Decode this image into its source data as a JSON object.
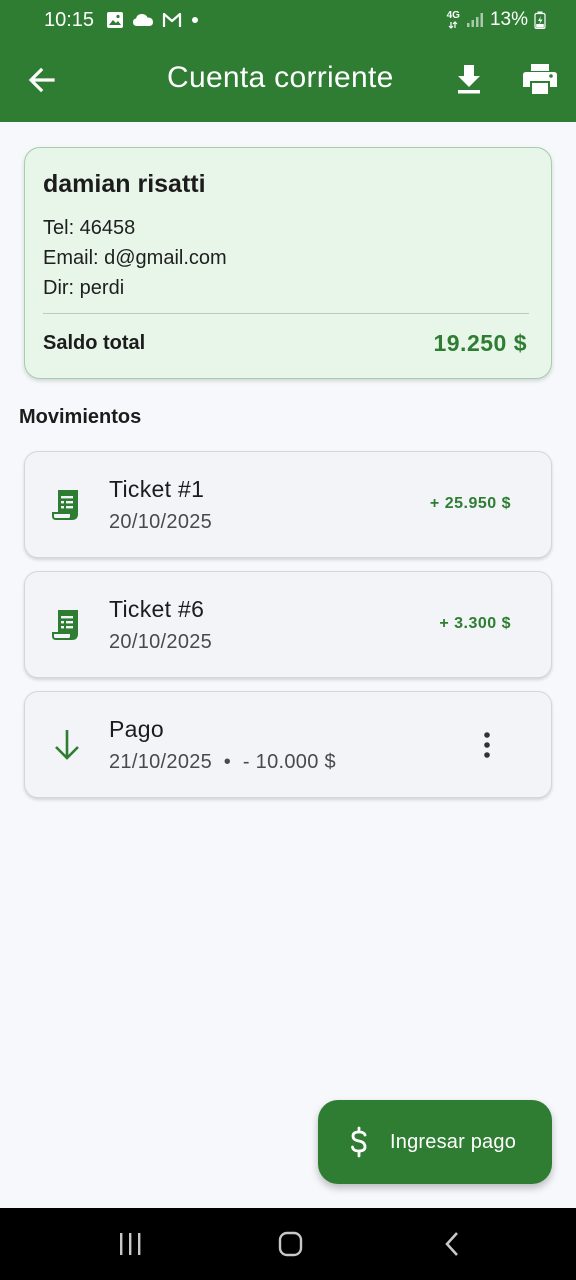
{
  "status_bar": {
    "time": "10:15",
    "network": "4G",
    "battery": "13%",
    "icons": [
      "gallery-icon",
      "cloud-icon",
      "gmail-icon",
      "dot-icon",
      "signal-icon",
      "battery-charging-icon"
    ]
  },
  "app_bar": {
    "title": "Cuenta corriente",
    "icons": [
      "back-arrow-icon",
      "download-icon",
      "print-icon"
    ]
  },
  "client": {
    "name": "damian risatti",
    "phone": "Tel: 46458",
    "email": "Email: d@gmail.com",
    "address": "Dir: perdi",
    "saldo_label": "Saldo total",
    "saldo_value": "19.250 $"
  },
  "movements_title": "Movimientos",
  "movements": [
    {
      "type": "ticket",
      "icon": "receipt-icon",
      "title": "Ticket #1",
      "date": "20/10/2025",
      "amount": "+ 25.950 $"
    },
    {
      "type": "ticket",
      "icon": "receipt-icon",
      "title": "Ticket #6",
      "date": "20/10/2025",
      "amount": "+ 3.300 $"
    },
    {
      "type": "payment",
      "icon": "arrow-down-icon",
      "title": "Pago",
      "subtitle": "21/10/2025  •  - 10.000 $"
    }
  ],
  "fab": {
    "label": "Ingresar pago",
    "icon": "dollar-icon"
  },
  "colors": {
    "primary": "#2e7d32",
    "card_bg": "#e8f5e9",
    "background": "#f7f8fc"
  }
}
